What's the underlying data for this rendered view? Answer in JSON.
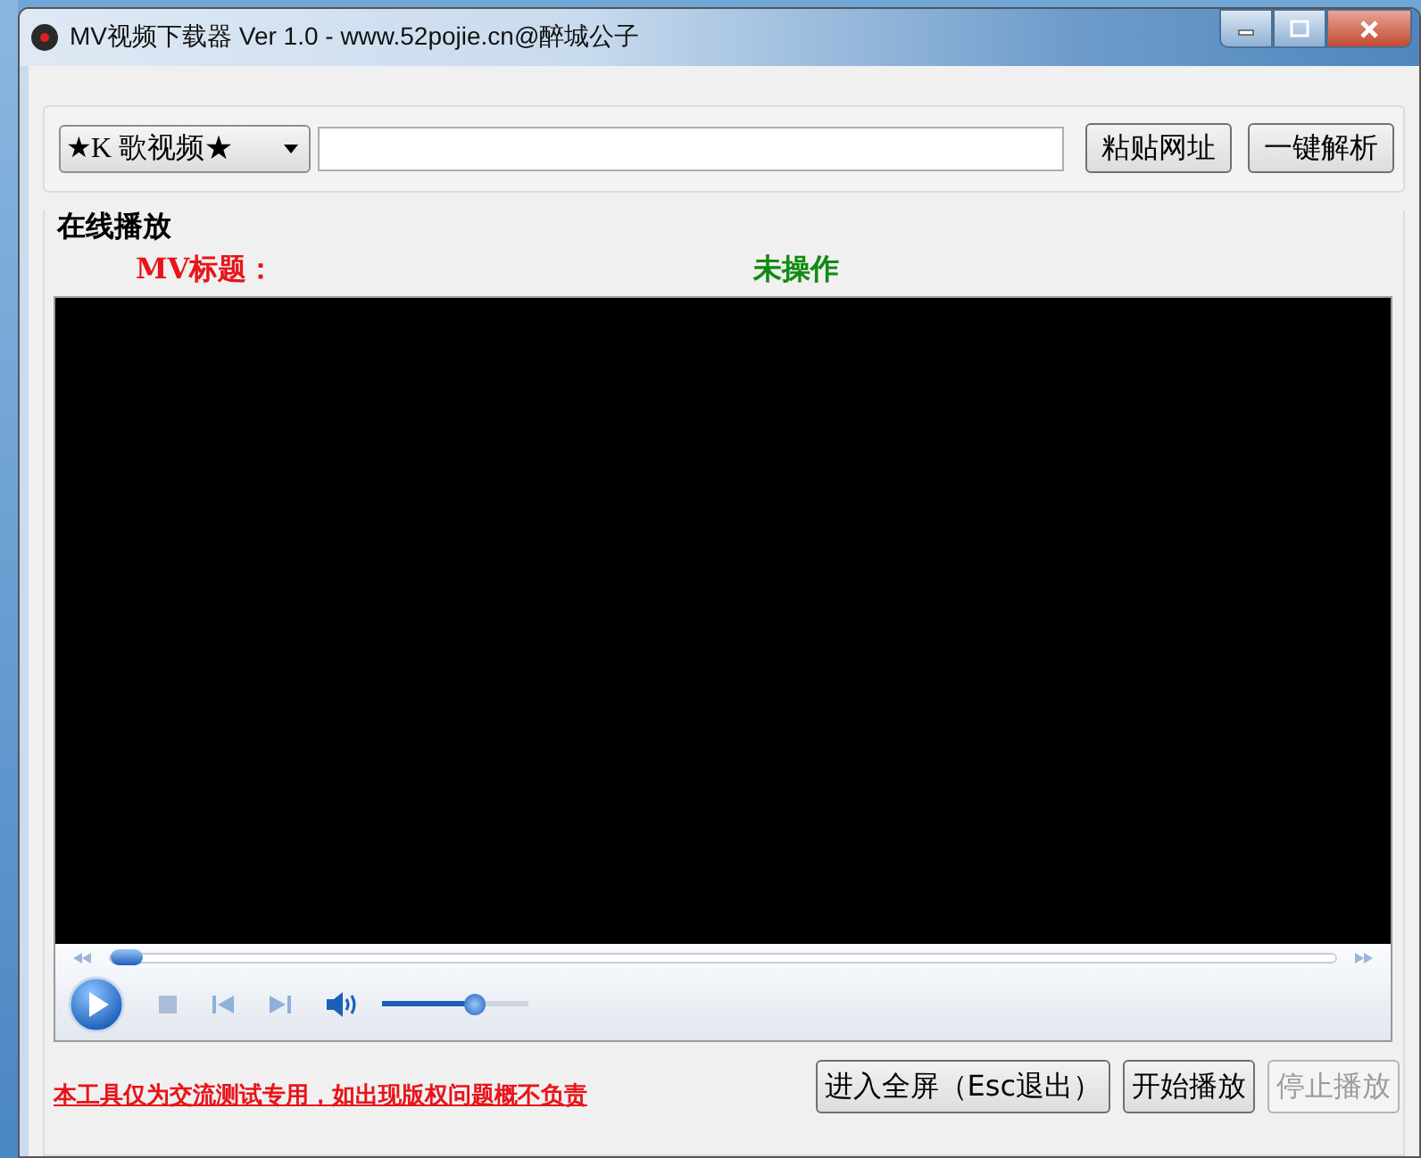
{
  "window": {
    "title": "MV视频下载器 Ver 1.0 - www.52pojie.cn@醉城公子"
  },
  "toolbar": {
    "source_select": {
      "value": "★K 歌视频★"
    },
    "buttons": [
      {
        "label": "粘贴网址"
      },
      {
        "label": "一键解析"
      }
    ]
  },
  "player_group": {
    "title": "在线播放",
    "mv_title_label": "MV标题：",
    "status": "未操作",
    "controls": {
      "seek": {
        "level": 0.0
      },
      "volume": {
        "level": 0.66
      }
    }
  },
  "notice": "本工具仅为交流测试专用，如出现版权问题概不负责",
  "bottom_buttons": [
    {
      "label": "进入全屏（Esc退出）",
      "disabled": false
    },
    {
      "label": "开始播放",
      "disabled": false
    },
    {
      "label": "停止播放",
      "disabled": true
    }
  ]
}
